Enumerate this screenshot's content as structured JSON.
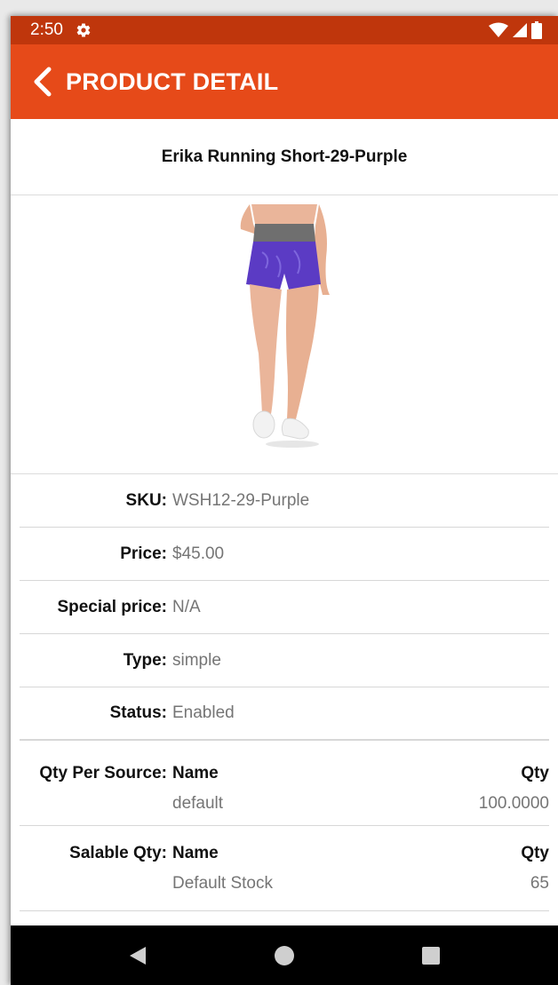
{
  "status_bar": {
    "time": "2:50"
  },
  "app_bar": {
    "title": "PRODUCT DETAIL"
  },
  "product": {
    "name": "Erika Running Short-29-Purple",
    "details": [
      {
        "label": "SKU:",
        "value": "WSH12-29-Purple"
      },
      {
        "label": "Price:",
        "value": "$45.00"
      },
      {
        "label": "Special price:",
        "value": "N/A"
      },
      {
        "label": "Type:",
        "value": "simple"
      },
      {
        "label": "Status:",
        "value": "Enabled"
      }
    ],
    "qty_per_source": {
      "label": "Qty Per Source:",
      "col_name": "Name",
      "col_qty": "Qty",
      "source": "default",
      "qty": "100.0000"
    },
    "salable_qty": {
      "label": "Salable Qty:",
      "col_name": "Name",
      "col_qty": "Qty",
      "source": "Default Stock",
      "qty": "65"
    }
  },
  "colors": {
    "status_bar": "#bf360c",
    "app_bar": "#e64a19",
    "shorts": "#5b3bc4",
    "waistband": "#6f6f6f"
  }
}
